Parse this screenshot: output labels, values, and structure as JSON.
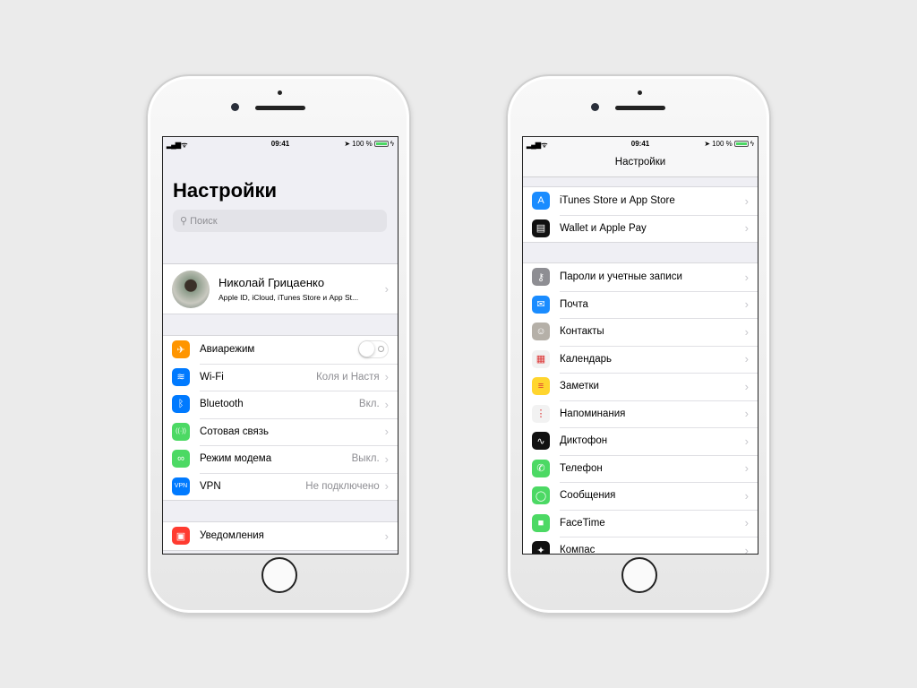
{
  "status": {
    "time": "09:41",
    "battery": "100 %",
    "battery_level": 100
  },
  "left": {
    "title": "Настройки",
    "search_placeholder": "Поиск",
    "profile": {
      "name": "Николай Грицаенко",
      "subtitle": "Apple ID, iCloud, iTunes Store и App St..."
    },
    "group1": [
      {
        "label": "Авиарежим",
        "icon": "airplane-icon",
        "glyph": "✈",
        "color": "#ff9500",
        "toggle": false
      },
      {
        "label": "Wi-Fi",
        "icon": "wifi-icon",
        "glyph": "≋",
        "color": "#007aff",
        "value": "Коля и Настя"
      },
      {
        "label": "Bluetooth",
        "icon": "bluetooth-icon",
        "glyph": "ᛒ",
        "color": "#007aff",
        "value": "Вкл."
      },
      {
        "label": "Сотовая связь",
        "icon": "cellular-icon",
        "glyph": "((·))",
        "color": "#4cd964"
      },
      {
        "label": "Режим модема",
        "icon": "hotspot-icon",
        "glyph": "∞",
        "color": "#4cd964",
        "value": "Выкл."
      },
      {
        "label": "VPN",
        "icon": "vpn-icon",
        "glyph": "VPN",
        "color": "#007aff",
        "value": "Не подключено"
      }
    ],
    "group2": [
      {
        "label": "Уведомления",
        "icon": "notifications-icon",
        "glyph": "▣",
        "color": "#ff3b30"
      }
    ]
  },
  "right": {
    "title": "Настройки",
    "group1": [
      {
        "label": "iTunes Store и App Store",
        "icon": "app-store-icon",
        "glyph": "A",
        "color": "#1a8cff"
      },
      {
        "label": "Wallet и Apple Pay",
        "icon": "wallet-icon",
        "glyph": "▤",
        "color": "#111111"
      }
    ],
    "group2": [
      {
        "label": "Пароли и учетные записи",
        "icon": "key-icon",
        "glyph": "⚷",
        "color": "#8e8e93"
      },
      {
        "label": "Почта",
        "icon": "mail-icon",
        "glyph": "✉",
        "color": "#1a8cff"
      },
      {
        "label": "Контакты",
        "icon": "contacts-icon",
        "glyph": "☺",
        "color": "#b5b0a8"
      },
      {
        "label": "Календарь",
        "icon": "calendar-icon",
        "glyph": "▦",
        "color": "#f2f2f2"
      },
      {
        "label": "Заметки",
        "icon": "notes-icon",
        "glyph": "≡",
        "color": "#ffd52e"
      },
      {
        "label": "Напоминания",
        "icon": "reminders-icon",
        "glyph": "⋮",
        "color": "#f2f2f2"
      },
      {
        "label": "Диктофон",
        "icon": "voice-memos-icon",
        "glyph": "∿",
        "color": "#111111"
      },
      {
        "label": "Телефон",
        "icon": "phone-icon",
        "glyph": "✆",
        "color": "#4cd964"
      },
      {
        "label": "Сообщения",
        "icon": "messages-icon",
        "glyph": "◯",
        "color": "#4cd964"
      },
      {
        "label": "FaceTime",
        "icon": "facetime-icon",
        "glyph": "■",
        "color": "#4cd964"
      },
      {
        "label": "Компас",
        "icon": "compass-icon",
        "glyph": "✦",
        "color": "#111111"
      }
    ]
  }
}
